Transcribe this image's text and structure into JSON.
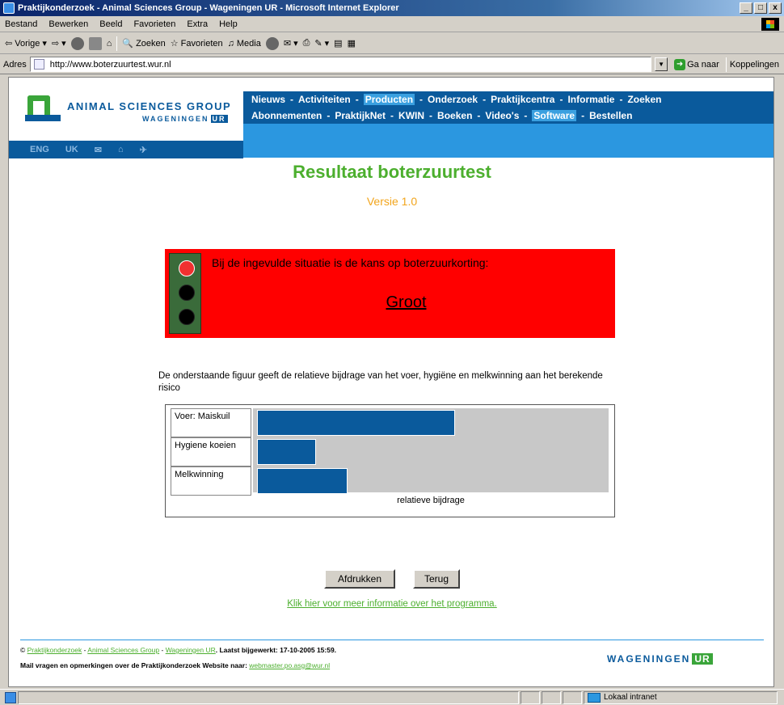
{
  "window": {
    "title": "Praktijkonderzoek - Animal Sciences Group - Wageningen UR - Microsoft Internet Explorer",
    "btn_min": "_",
    "btn_max": "□",
    "btn_close": "x"
  },
  "menu": [
    "Bestand",
    "Bewerken",
    "Beeld",
    "Favorieten",
    "Extra",
    "Help"
  ],
  "toolbar": {
    "back": "Vorige",
    "search": "Zoeken",
    "favorites": "Favorieten",
    "media": "Media"
  },
  "address": {
    "label": "Adres",
    "url": "http://www.boterzuurtest.wur.nl",
    "go": "Ga naar",
    "links": "Koppelingen"
  },
  "logo": {
    "line1": "ANIMAL SCIENCES GROUP",
    "line2": "WAGENINGEN",
    "ur": "UR"
  },
  "nav1": [
    "Nieuws",
    "Activiteiten",
    "Producten",
    "Onderzoek",
    "Praktijkcentra",
    "Informatie",
    "Zoeken"
  ],
  "nav2": [
    "Abonnementen",
    "PraktijkNet",
    "KWIN",
    "Boeken",
    "Video's",
    "Software",
    "Bestellen"
  ],
  "iconbar": [
    "ENG",
    "UK",
    "✉",
    "⌂",
    "✈"
  ],
  "page": {
    "title": "Resultaat boterzuurtest",
    "version": "Versie 1.0",
    "risk_question": "Bij de ingevulde situatie is de kans op boterzuurkorting:",
    "risk_answer": "Groot",
    "description": "De onderstaande figuur geeft de relatieve bijdrage van het voer, hygiëne en melkwinning aan het berekende risico",
    "print_button": "Afdrukken",
    "back_button": "Terug",
    "more_info": "Klik hier voor meer informatie over het programma."
  },
  "chart_data": {
    "type": "bar",
    "categories": [
      "Voer: Maiskuil",
      "Hygiene koeien",
      "Melkwinning"
    ],
    "values": [
      0.57,
      0.17,
      0.26
    ],
    "xlabel": "relatieve bijdrage",
    "ylabel": "",
    "xlim": [
      0,
      1
    ]
  },
  "footer": {
    "copyright": "©",
    "link1": "Praktijkonderzoek",
    "link2": "Animal Sciences Group",
    "link3": "Wageningen UR",
    "updated": ". Laatst bijgewerkt: 17-10-2005 15:59.",
    "mail_text": "Mail vragen en opmerkingen over de Praktijkonderzoek Website naar:",
    "mail_link": "webmaster.po.asg@wur.nl",
    "logo": "WAGENINGEN",
    "logo_ur": "UR"
  },
  "status": {
    "zone": "Lokaal intranet"
  },
  "colors": {
    "brand_blue": "#0a5a9c",
    "brand_green": "#4caf2e",
    "risk_red": "#ff0000",
    "version_orange": "#f2a51c"
  }
}
